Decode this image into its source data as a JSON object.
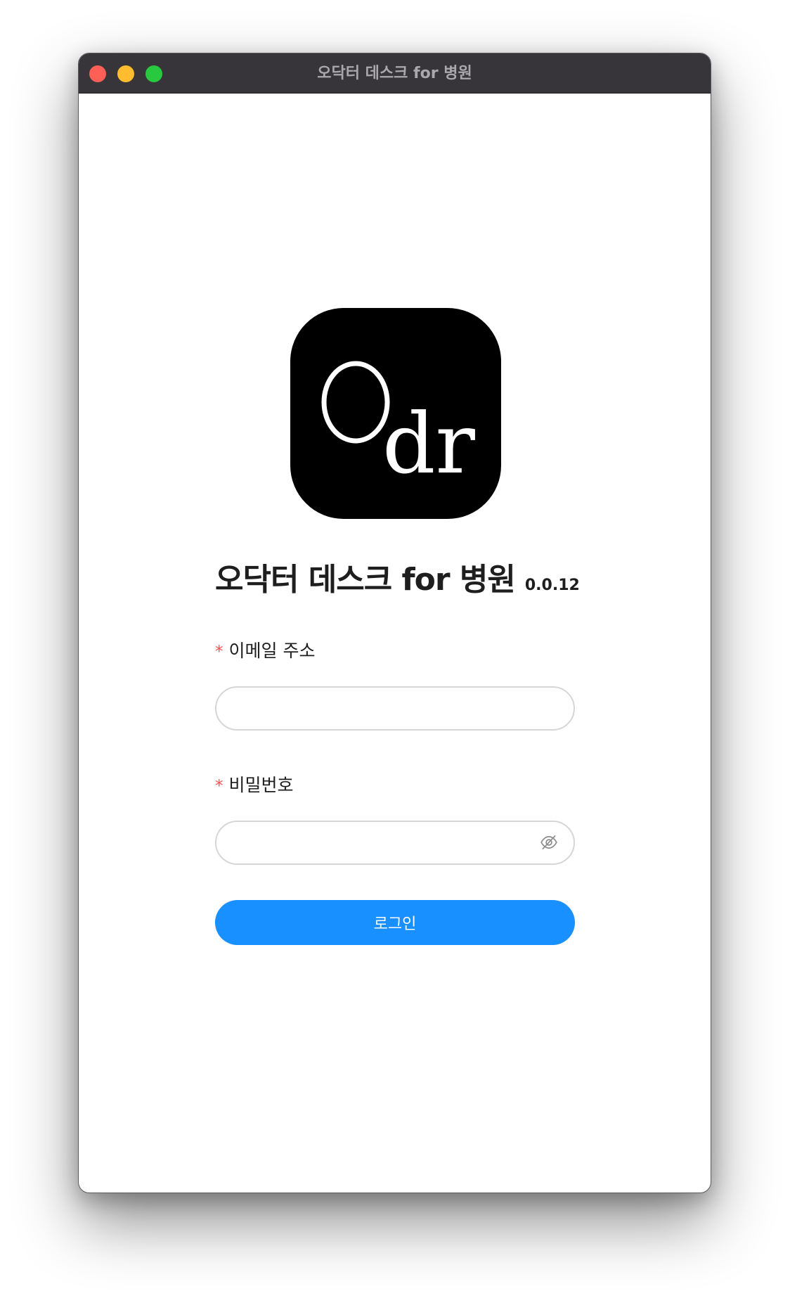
{
  "window": {
    "title": "오닥터 데스크 for 병원",
    "buttons": [
      "close",
      "minimize",
      "maximize"
    ]
  },
  "logo": {
    "text_large": "O",
    "text_small": "dr",
    "background": "#000000",
    "foreground": "#ffffff"
  },
  "heading": {
    "app_name": "오닥터 데스크 for 병원",
    "version": "0.0.12"
  },
  "form": {
    "email": {
      "required_mark": "*",
      "label": "이메일 주소",
      "value": "",
      "placeholder": ""
    },
    "password": {
      "required_mark": "*",
      "label": "비밀번호",
      "value": "",
      "placeholder": "",
      "toggle_icon": "eye-invisible-icon"
    },
    "submit_label": "로그인"
  },
  "colors": {
    "primary": "#1890ff",
    "required": "#ff4d4f",
    "titlebar": "#38353a",
    "close": "#fe5f57",
    "minimize": "#febc2e",
    "maximize": "#28c840"
  }
}
